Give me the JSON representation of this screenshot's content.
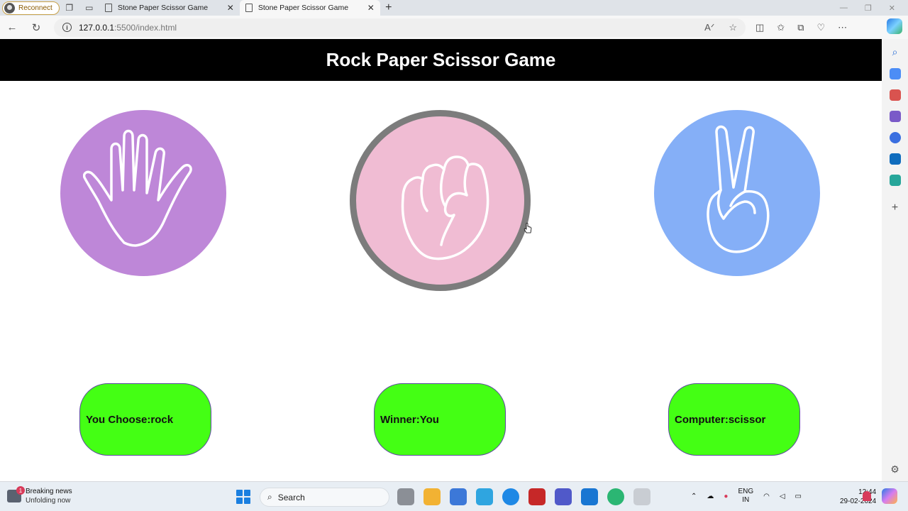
{
  "browser": {
    "reconnect_label": "Reconnect",
    "tabs": [
      {
        "title": "Stone Paper Scissor Game",
        "active": false
      },
      {
        "title": "Stone Paper Scissor Game",
        "active": true
      }
    ],
    "url_host": "127.0.0.1",
    "url_path": ":5500/index.html"
  },
  "game": {
    "title": "Rock Paper Scissor Game",
    "choices": [
      {
        "id": "paper",
        "icon": "open-hand-icon",
        "color": "#be87d8"
      },
      {
        "id": "rock",
        "icon": "fist-icon",
        "color": "#f0bcd3",
        "selected": true
      },
      {
        "id": "scissor",
        "icon": "peace-hand-icon",
        "color": "#85aff7"
      }
    ],
    "results": {
      "user": "You Choose:rock",
      "winner": "Winner:You",
      "computer": "Computer:scissor"
    },
    "result_color": "#44ff14"
  },
  "taskbar": {
    "news_title": "Breaking news",
    "news_sub": "Unfolding now",
    "news_badge": "1",
    "search_label": "Search",
    "lang_top": "ENG",
    "lang_bottom": "IN",
    "time": "12:44",
    "date": "29-02-2024"
  }
}
